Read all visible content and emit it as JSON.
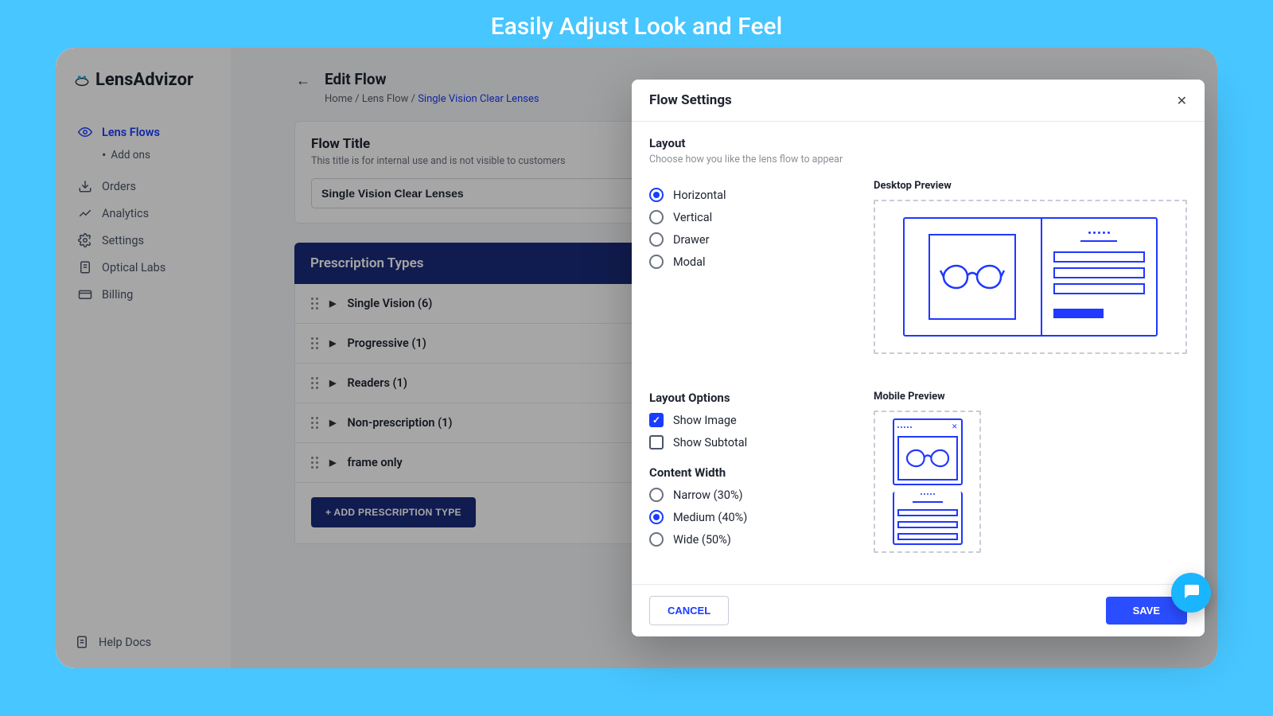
{
  "banner": "Easily Adjust Look and Feel",
  "app_name": "LensAdvizor",
  "sidebar": {
    "lens_flows": "Lens Flows",
    "add_ons": "Add ons",
    "orders": "Orders",
    "analytics": "Analytics",
    "settings": "Settings",
    "optical_labs": "Optical Labs",
    "billing": "Billing",
    "help_docs": "Help Docs"
  },
  "page": {
    "title": "Edit Flow",
    "crumb_home": "Home",
    "crumb_mid": "Lens Flow",
    "crumb_last": "Single Vision Clear Lenses"
  },
  "flow_title_card": {
    "heading": "Flow Title",
    "hint": "This title is for internal use and is not visible to customers",
    "value": "Single Vision Clear Lenses"
  },
  "prescription": {
    "heading": "Prescription Types",
    "rows": [
      "Single Vision (6)",
      "Progressive (1)",
      "Readers (1)",
      "Non-prescription (1)",
      "frame only"
    ],
    "add_button": "+ ADD PRESCRIPTION TYPE"
  },
  "modal": {
    "title": "Flow Settings",
    "layout_heading": "Layout",
    "layout_sub": "Choose how you like the lens flow to appear",
    "radios": {
      "horizontal": "Horizontal",
      "vertical": "Vertical",
      "drawer": "Drawer",
      "modal": "Modal"
    },
    "desktop_preview": "Desktop Preview",
    "layout_options_heading": "Layout Options",
    "show_image": "Show Image",
    "show_subtotal": "Show Subtotal",
    "mobile_preview": "Mobile Preview",
    "content_width_heading": "Content Width",
    "width_radios": {
      "narrow": "Narrow (30%)",
      "medium": "Medium (40%)",
      "wide": "Wide (50%)"
    },
    "cancel": "CANCEL",
    "save": "SAVE"
  }
}
